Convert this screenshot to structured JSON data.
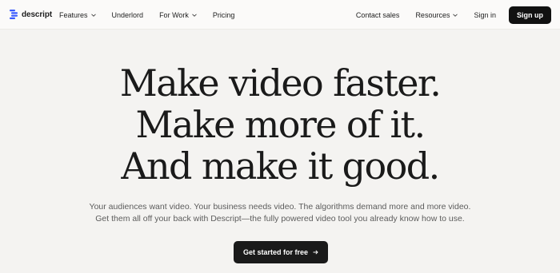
{
  "brand": {
    "name": "descript",
    "logo_icon": "descript-logo-icon",
    "accent_color": "#3b5bff"
  },
  "nav": {
    "left_items": [
      {
        "label": "Features",
        "has_dropdown": true
      },
      {
        "label": "Underlord",
        "has_dropdown": false
      },
      {
        "label": "For Work",
        "has_dropdown": true
      },
      {
        "label": "Pricing",
        "has_dropdown": false
      }
    ],
    "right_items": [
      {
        "label": "Contact sales",
        "has_dropdown": false
      },
      {
        "label": "Resources",
        "has_dropdown": true
      },
      {
        "label": "Sign in",
        "has_dropdown": false
      }
    ],
    "signup_label": "Sign up"
  },
  "hero": {
    "lines": [
      "Make video faster.",
      "Make more of it.",
      "And make it good."
    ],
    "subtitle_lines": [
      "Your audiences want video. Your business needs video. The algorithms demand more and more video.",
      "Get them all off your back with Descript—the fully powered video tool you already know how to use."
    ],
    "cta_label": "Get started for free",
    "cta_icon": "arrow-right-icon"
  },
  "colors": {
    "background": "#f4f3f1",
    "button_dark": "#111111"
  }
}
